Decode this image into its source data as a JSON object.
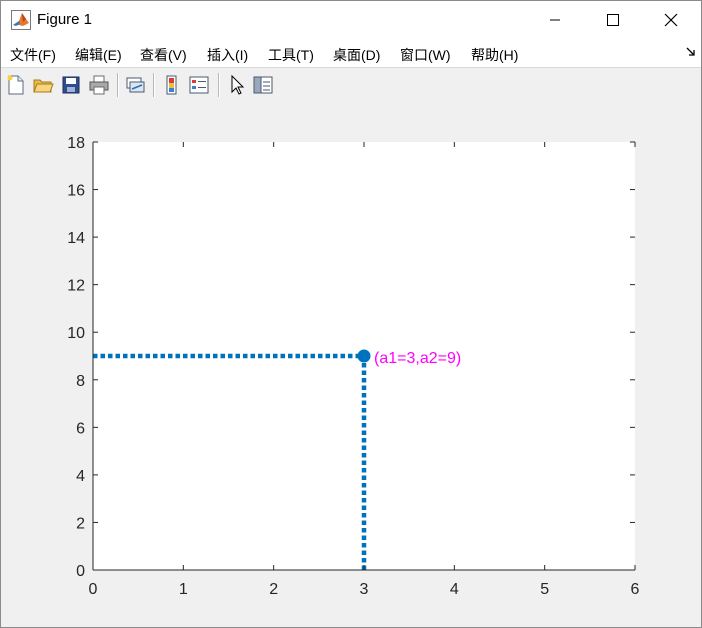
{
  "window": {
    "title": "Figure 1"
  },
  "menu": {
    "items": [
      "文件(F)",
      "编辑(E)",
      "查看(V)",
      "插入(I)",
      "工具(T)",
      "桌面(D)",
      "窗口(W)",
      "帮助(H)"
    ]
  },
  "toolbar": {
    "buttons": [
      "new-figure-icon",
      "open-file-icon",
      "save-icon",
      "print-icon",
      "link-plot-icon",
      "colorbar-icon",
      "legend-icon",
      "pointer-icon",
      "property-editor-icon"
    ]
  },
  "colors": {
    "line": "#0072bd",
    "annotation": "#ff00ff",
    "axes_background": "#ffffff",
    "figure_background": "#f0f0f0"
  },
  "chart_data": {
    "type": "line",
    "xlim": [
      0,
      6
    ],
    "ylim": [
      0,
      18
    ],
    "xticks": [
      0,
      1,
      2,
      3,
      4,
      5,
      6
    ],
    "yticks": [
      0,
      2,
      4,
      6,
      8,
      10,
      12,
      14,
      16,
      18
    ],
    "grid": false,
    "series": [
      {
        "style": "dotted",
        "x": [
          0,
          3
        ],
        "y": [
          9,
          9
        ]
      },
      {
        "style": "dotted",
        "x": [
          3,
          3
        ],
        "y": [
          0,
          9
        ]
      },
      {
        "style": "marker",
        "x": [
          3
        ],
        "y": [
          9
        ]
      }
    ],
    "annotations": [
      {
        "x": 3,
        "y": 9,
        "text": "(a1=3,a2=9)"
      }
    ]
  }
}
